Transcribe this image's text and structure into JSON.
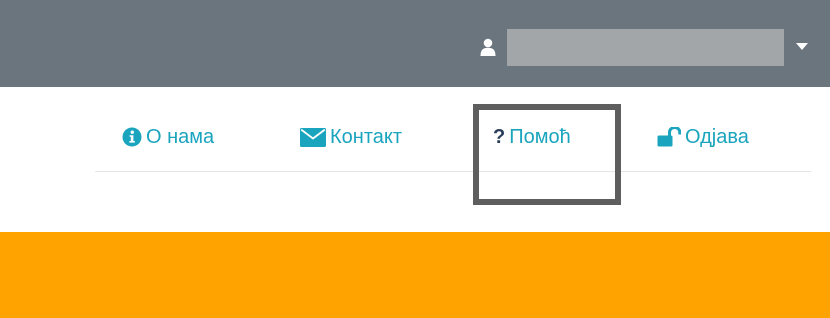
{
  "topbar": {
    "user_icon": "user-icon",
    "user_name": "",
    "dropdown_icon": "caret-down-icon",
    "bg_color": "#6b757d"
  },
  "nav": {
    "items": [
      {
        "label": "О нама",
        "icon": "info-circle-icon"
      },
      {
        "label": "Контакт",
        "icon": "envelope-icon"
      },
      {
        "label": "Помоћ",
        "icon": "question-icon"
      },
      {
        "label": "Одјава",
        "icon": "unlock-icon"
      }
    ],
    "link_color": "#1aa4bd"
  },
  "highlight": {
    "target": "Помоћ",
    "border_color": "#5e5e5e"
  },
  "banner": {
    "color": "#ffa300"
  }
}
